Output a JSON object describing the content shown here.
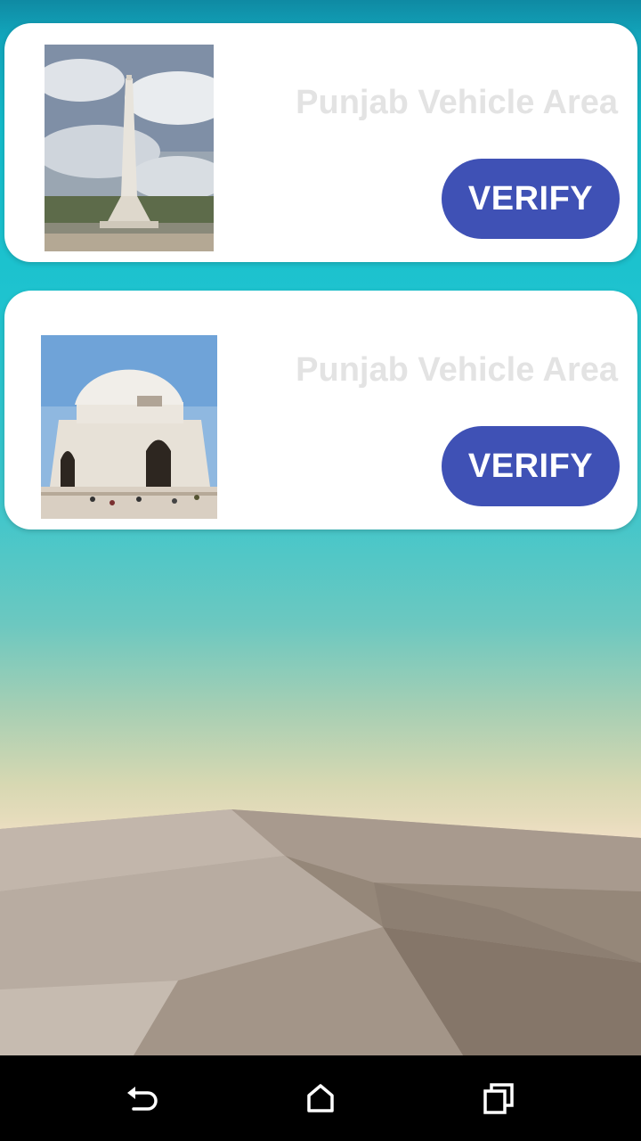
{
  "cards": [
    {
      "title": "Punjab Vehicle Area",
      "button_label": "VERIFY",
      "image": "minar-e-pakistan-photo"
    },
    {
      "title": "Punjab Vehicle Area",
      "button_label": "VERIFY",
      "image": "mazar-e-quaid-photo"
    }
  ],
  "navbar": {
    "icons": [
      "back-icon",
      "home-icon",
      "recents-icon"
    ]
  },
  "colors": {
    "button": "#3f51b5",
    "title_text": "#e3e3e3",
    "navbar": "#000000"
  }
}
